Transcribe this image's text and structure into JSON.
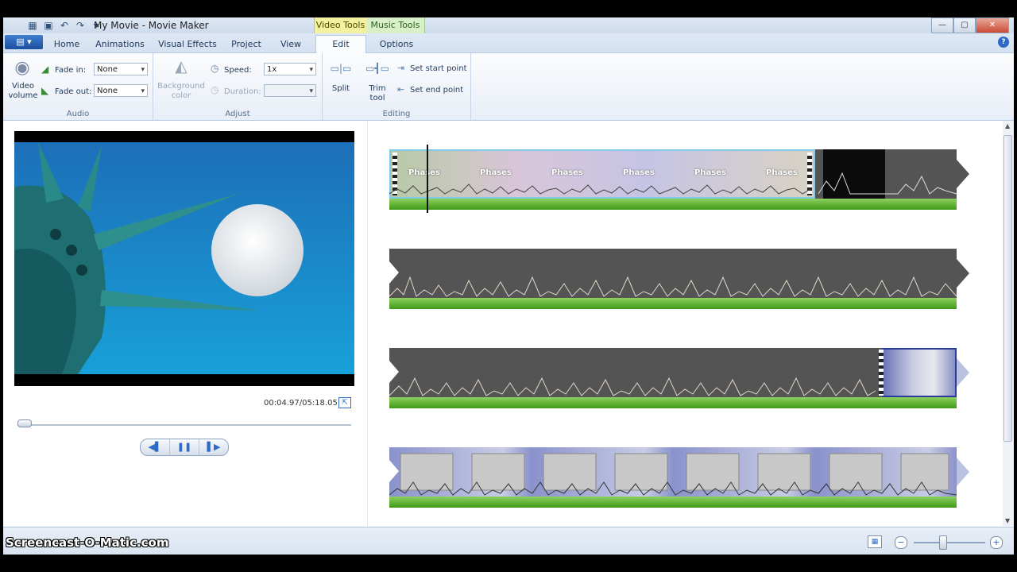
{
  "window": {
    "title": "My Movie - Movie Maker",
    "context_tabs": {
      "video_tools": "Video Tools",
      "music_tools": "Music Tools"
    },
    "buttons": {
      "minimize": "—",
      "maximize": "▢",
      "close": "✕"
    }
  },
  "tabs": [
    {
      "label": "Home"
    },
    {
      "label": "Animations"
    },
    {
      "label": "Visual Effects"
    },
    {
      "label": "Project"
    },
    {
      "label": "View"
    },
    {
      "label": "Edit"
    },
    {
      "label": "Options"
    }
  ],
  "ribbon": {
    "audio": {
      "label": "Audio",
      "video_volume": "Video volume",
      "fade_in_label": "Fade in:",
      "fade_in_value": "None",
      "fade_out_label": "Fade out:",
      "fade_out_value": "None"
    },
    "adjust": {
      "label": "Adjust",
      "background_color": "Background color",
      "speed_label": "Speed:",
      "speed_value": "1x",
      "duration_label": "Duration:",
      "duration_value": ""
    },
    "editing": {
      "label": "Editing",
      "split": "Split",
      "trim_tool": "Trim tool",
      "set_start_point": "Set start point",
      "set_end_point": "Set end point"
    }
  },
  "preview": {
    "timecode": "00:04.97/05:18.05",
    "controls": {
      "previous": "◀▌",
      "pause": "❚❚",
      "next": "▌▶"
    }
  },
  "storyboard": {
    "caption_text": "Phases",
    "captions_count_row1": 6
  },
  "status": {
    "watermark": "Screencast-O-Matic.com",
    "zoom_out": "−",
    "zoom_in": "+"
  }
}
